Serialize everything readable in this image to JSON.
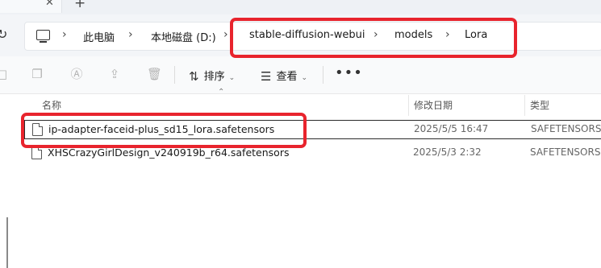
{
  "tab": {
    "close_glyph": "✕",
    "new_tab_glyph": "+"
  },
  "breadcrumb": {
    "items": [
      "此电脑",
      "本地磁盘 (D:)",
      "stable-diffusion-webui",
      "models",
      "Lora"
    ],
    "separator": "›"
  },
  "toolbar": {
    "sort_label": "排序",
    "view_label": "查看",
    "more_label": "•••"
  },
  "columns": {
    "name": "名称",
    "date": "修改日期",
    "type": "类型"
  },
  "files": [
    {
      "name": "ip-adapter-faceid-plus_sd15_lora.safetensors",
      "date": "2025/5/5 16:47",
      "type": "SAFETENSORS",
      "selected": true
    },
    {
      "name": "XHSCrazyGirlDesign_v240919b_r64.safetensors",
      "date": "2025/5/3 2:32",
      "type": "SAFETENSORS",
      "selected": false
    }
  ],
  "colors": {
    "highlight": "#e8242d"
  }
}
